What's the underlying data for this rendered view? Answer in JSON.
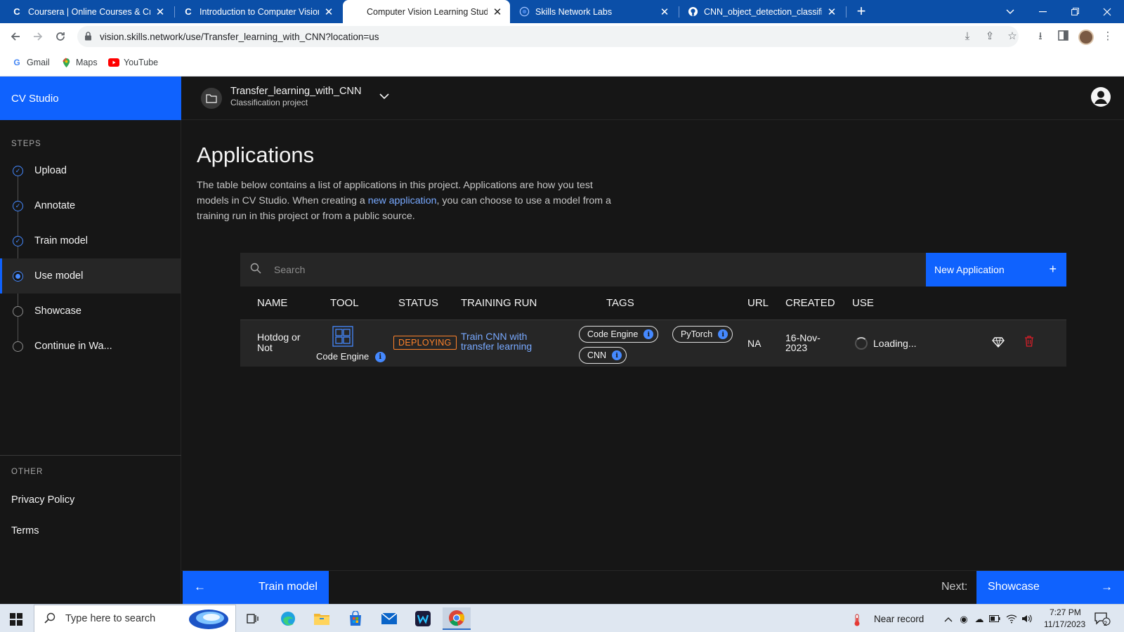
{
  "browser": {
    "tabs": [
      {
        "title": "Coursera | Online Courses & Cre",
        "icon": "coursera-icon"
      },
      {
        "title": "Introduction to Computer Vision",
        "icon": "coursera-icon"
      },
      {
        "title": "Computer Vision Learning Studio",
        "icon": "blank-icon"
      },
      {
        "title": "Skills Network Labs",
        "icon": "globe-icon"
      },
      {
        "title": "CNN_object_detection_classifier",
        "icon": "github-icon"
      }
    ],
    "url": "vision.skills.network/use/Transfer_learning_with_CNN?location=us",
    "bookmarks": [
      "Gmail",
      "Maps",
      "YouTube"
    ]
  },
  "app": {
    "brand": "CV Studio",
    "steps_heading": "STEPS",
    "steps": [
      {
        "label": "Upload",
        "state": "done"
      },
      {
        "label": "Annotate",
        "state": "done"
      },
      {
        "label": "Train model",
        "state": "done"
      },
      {
        "label": "Use model",
        "state": "active"
      },
      {
        "label": "Showcase",
        "state": "todo"
      },
      {
        "label": "Continue in Wa...",
        "state": "todo"
      }
    ],
    "other_heading": "OTHER",
    "other_links": [
      "Privacy Policy",
      "Terms"
    ],
    "project": {
      "name": "Transfer_learning_with_CNN",
      "type": "Classification project"
    },
    "page": {
      "title": "Applications",
      "desc_part1": "The table below contains a list of applications in this project. Applications are how you test models in CV Studio. When creating a ",
      "desc_link": "new application",
      "desc_part2": ", you can choose to use a model from a training run in this project or from a public source."
    },
    "table": {
      "search_placeholder": "Search",
      "new_button": "New Application",
      "headers": [
        "NAME",
        "TOOL",
        "STATUS",
        "TRAINING RUN",
        "TAGS",
        "URL",
        "CREATED",
        "USE"
      ],
      "rows": [
        {
          "name": "Hotdog or Not",
          "tool": "Code Engine",
          "status": "DEPLOYING",
          "training_run": "Train CNN with transfer learning",
          "tags": [
            "Code Engine",
            "PyTorch",
            "CNN"
          ],
          "url": "NA",
          "created": "16-Nov-2023",
          "use": "Loading..."
        }
      ]
    },
    "footer": {
      "prev_label": "Train model",
      "next_prefix": "Next:",
      "next_label": "Showcase"
    }
  },
  "taskbar": {
    "search_placeholder": "Type here to search",
    "weather": "Near record",
    "time": "7:27 PM",
    "date": "11/17/2023",
    "notifications": "2"
  },
  "colors": {
    "accent": "#0f62fe",
    "link": "#78a9ff",
    "status_deploying": "#ff832b",
    "delete": "#da1e28"
  }
}
